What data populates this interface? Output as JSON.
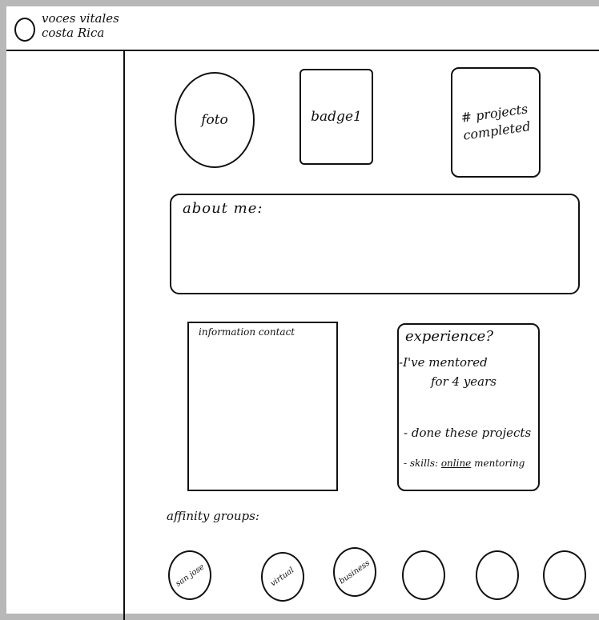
{
  "header": {
    "brand_text": "voces vitales\ncosta Rica"
  },
  "profile": {
    "photo_label": "foto",
    "badge_label": "badge1",
    "projects_label": "# projects completed"
  },
  "about": {
    "label": "about me:"
  },
  "info": {
    "label": "information contact"
  },
  "experience": {
    "title": "experience?",
    "line1": "-I've mentored",
    "line2": "for 4 years",
    "line3": "- done these projects",
    "skills_prefix": "- skills: ",
    "skills_underlined": "online",
    "skills_suffix": " mentoring"
  },
  "affinity": {
    "label": "affinity groups:",
    "groups": [
      "san jose",
      "virtual",
      "business",
      "",
      "",
      ""
    ]
  }
}
